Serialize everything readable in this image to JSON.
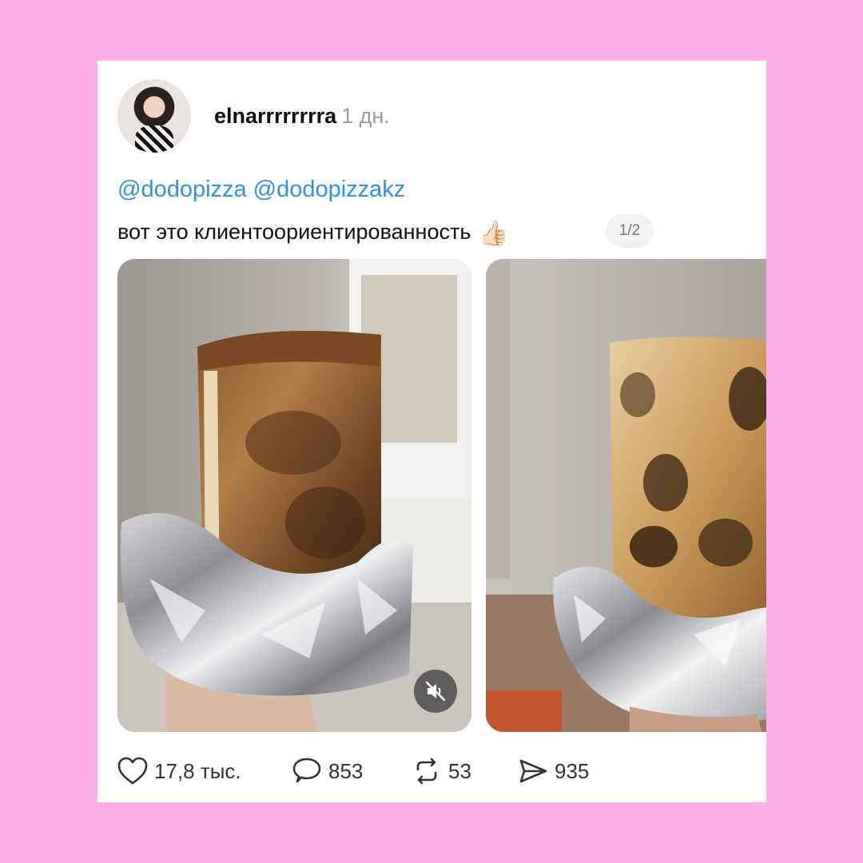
{
  "post": {
    "username": "elnarrrrrrrra",
    "time": "1 дн.",
    "mentions": [
      "@dodopizza",
      "@dodopizzakz"
    ],
    "caption": "вот это клиентоориентированность",
    "caption_emoji": "👍🏻",
    "carousel_counter": "1/2"
  },
  "media": {
    "video_muted_icon": "speaker-muted-icon"
  },
  "actions": {
    "likes": "17,8 тыс.",
    "comments": "853",
    "reposts": "53",
    "shares": "935"
  },
  "colors": {
    "background": "#fbb0e6",
    "card": "#ffffff",
    "mention": "#2f93d6",
    "muted_text": "#9a9a9a"
  }
}
